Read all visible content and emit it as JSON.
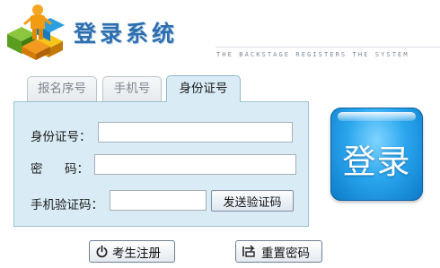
{
  "header": {
    "title": "登录系统",
    "subtitle": "THE BACKSTAGE REGISTERS THE SYSTEM"
  },
  "tabs": [
    {
      "label": "报名序号",
      "active": false
    },
    {
      "label": "手机号",
      "active": false
    },
    {
      "label": "身份证号",
      "active": true
    }
  ],
  "form": {
    "id_label": "身份证号：",
    "password_label_1": "密",
    "password_label_2": "码：",
    "sms_label": "手机验证码：",
    "id_value": "",
    "password_value": "",
    "sms_value": "",
    "send_sms_label": "发送验证码"
  },
  "login_button": {
    "label": "登录"
  },
  "bottom": {
    "register_label": "考生注册",
    "reset_label": "重置密码"
  },
  "colors": {
    "accent": "#2e6fb0",
    "panel_bg": "#d9ecf5",
    "login_button": "#2aa6ee"
  },
  "icons": {
    "logo": "people-cubes-logo-icon",
    "register": "power-icon",
    "reset": "reset-icon"
  }
}
